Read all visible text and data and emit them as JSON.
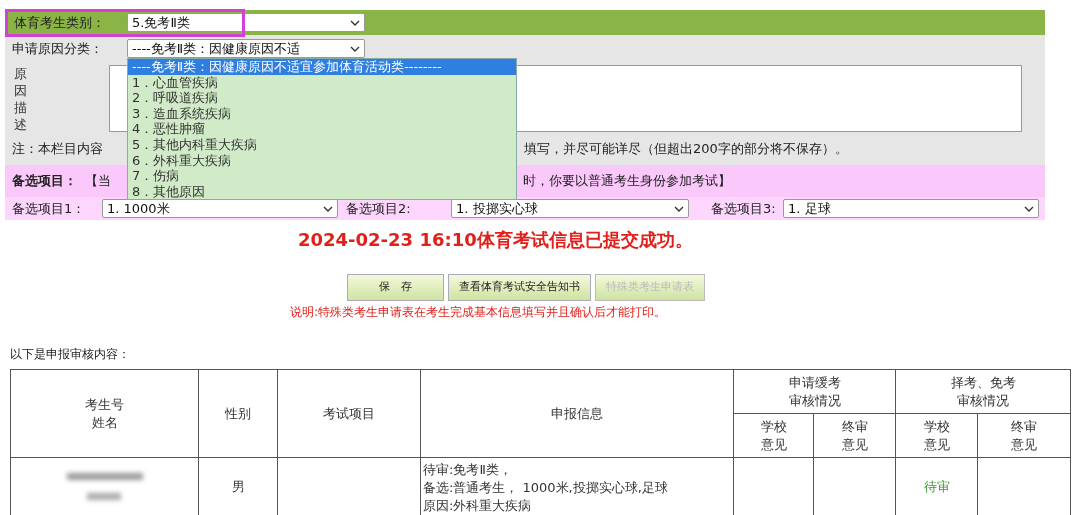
{
  "student_type": {
    "label": "体育考生类别：",
    "value": "5.免考Ⅱ类",
    "highlighted": true
  },
  "reason_category": {
    "label": "申请原因分类：",
    "value": "----免考Ⅱ类：因健康原因不适",
    "expanded": true,
    "options": [
      {
        "label": "----免考Ⅱ类：因健康原因不适宜参加体育活动类--------",
        "selected": true
      },
      {
        "label": "1．心血管疾病",
        "selected": false
      },
      {
        "label": "2．呼吸道疾病",
        "selected": false
      },
      {
        "label": "3．造血系统疾病",
        "selected": false
      },
      {
        "label": "4．恶性肿瘤",
        "selected": false
      },
      {
        "label": "5．其他内科重大疾病",
        "selected": false
      },
      {
        "label": "6．外科重大疾病",
        "selected": false
      },
      {
        "label": "7．伤病",
        "selected": false
      },
      {
        "label": "8．其他原因",
        "selected": false
      }
    ]
  },
  "description": {
    "label": "原因描述"
  },
  "note": [
    "注：本栏目内容",
    "填写，并尽可能详尽（但超出200字的部分将不保存）。"
  ],
  "alternatives": {
    "title": "备选项目：",
    "notice": [
      "【当",
      "时，你要以普通考生身份参加考试】"
    ],
    "selects": [
      {
        "label": "备选项目1：",
        "value": "1. 1000米"
      },
      {
        "label": "备选项目2:",
        "value": "1. 投掷实心球"
      },
      {
        "label": "备选项目3:",
        "value": "1. 足球"
      }
    ]
  },
  "success_message": "2024-02-23 16:10体育考试信息已提交成功。",
  "buttons": [
    {
      "label": "保　存",
      "disabled": false
    },
    {
      "label": "查看体育考试安全告知书",
      "disabled": false
    },
    {
      "label": "特殊类考生申请表",
      "disabled": true
    }
  ],
  "explanation": "说明:特殊类考生申请表在考生完成基本信息填写并且确认后才能打印。",
  "review_title": "以下是申报审核内容：",
  "table": {
    "columns": [
      {
        "lines": [
          "考生号",
          "姓名"
        ]
      },
      {
        "lines": [
          "性别"
        ]
      },
      {
        "lines": [
          "考试项目"
        ]
      },
      {
        "lines": [
          "申报信息"
        ]
      },
      {
        "lines": [
          "申请缓考",
          "审核情况"
        ],
        "sub": [
          {
            "lines": [
              "学校",
              "意见"
            ]
          },
          {
            "lines": [
              "终审",
              "意见"
            ]
          }
        ]
      },
      {
        "lines": [
          "择考、免考",
          "审核情况"
        ],
        "sub": [
          {
            "lines": [
              "学校",
              "意见"
            ]
          },
          {
            "lines": [
              "终审",
              "意见"
            ]
          }
        ]
      }
    ],
    "rows": [
      {
        "gender": "男",
        "info": [
          "待审:免考Ⅱ类，",
          "备选:普通考生， 1000米,投掷实心球,足球",
          "原因:外科重大疾病"
        ],
        "exemption_school_review": "待审"
      }
    ]
  }
}
